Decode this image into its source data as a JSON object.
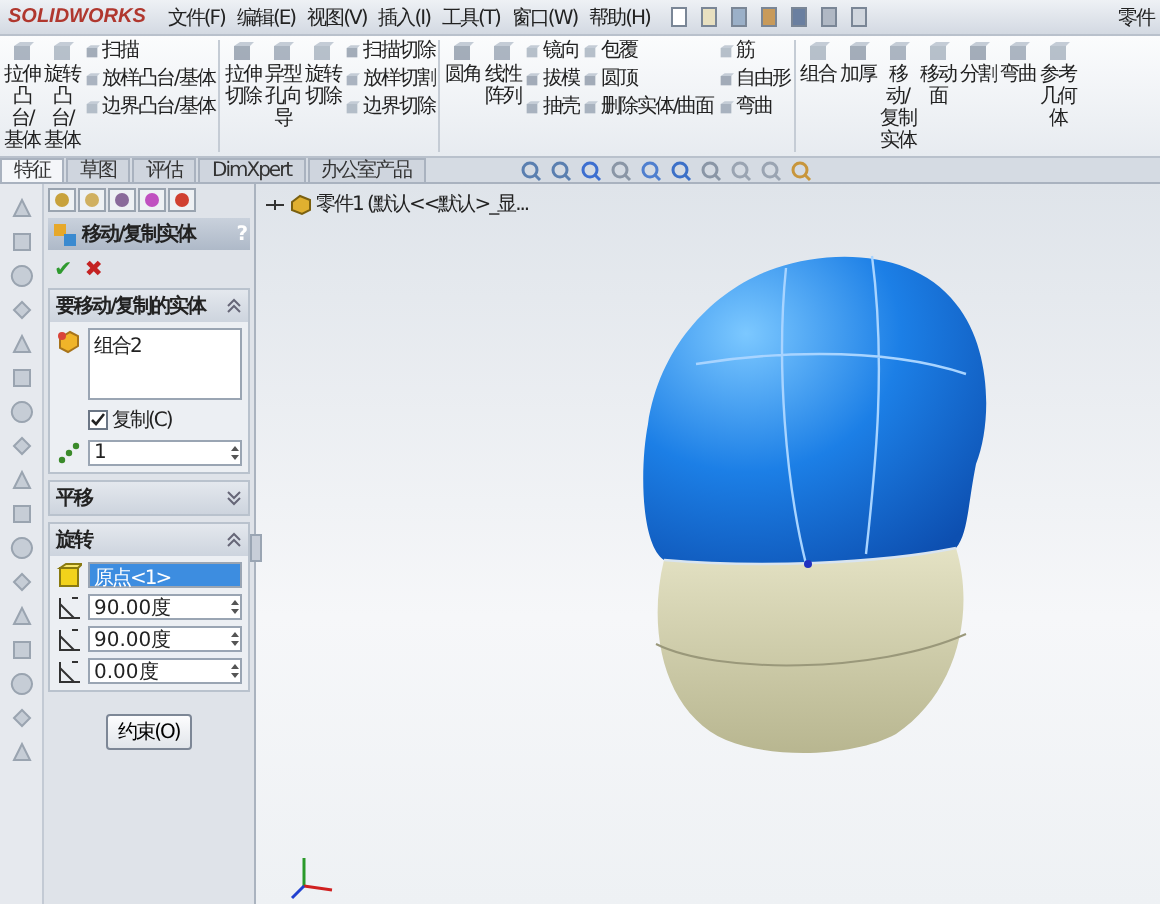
{
  "app": {
    "logo": "SOLIDWORKS",
    "menu": [
      "文件(F)",
      "编辑(E)",
      "视图(V)",
      "插入(I)",
      "工具(T)",
      "窗口(W)",
      "帮助(H)"
    ],
    "doc_title": "零件"
  },
  "ribbon": [
    {
      "kind": "large",
      "label": "拉伸凸台/基体"
    },
    {
      "kind": "large",
      "label": "旋转凸台/基体"
    },
    {
      "kind": "stack",
      "labels": [
        "扫描",
        "放样凸台/基体",
        "边界凸台/基体"
      ]
    },
    {
      "kind": "divider"
    },
    {
      "kind": "large",
      "label": "拉伸切除"
    },
    {
      "kind": "large",
      "label": "异型孔向导"
    },
    {
      "kind": "large",
      "label": "旋转切除"
    },
    {
      "kind": "stack",
      "labels": [
        "扫描切除",
        "放样切割",
        "边界切除"
      ]
    },
    {
      "kind": "divider"
    },
    {
      "kind": "large",
      "label": "圆角"
    },
    {
      "kind": "large",
      "label": "线性阵列"
    },
    {
      "kind": "stack",
      "labels": [
        "镜向",
        "拔模",
        "抽壳"
      ]
    },
    {
      "kind": "stack",
      "labels": [
        "包覆",
        "圆顶",
        "删除实体/曲面"
      ]
    },
    {
      "kind": "stack",
      "labels": [
        "筋",
        "自由形",
        "弯曲"
      ]
    },
    {
      "kind": "divider"
    },
    {
      "kind": "large",
      "label": "组合"
    },
    {
      "kind": "large",
      "label": "加厚"
    },
    {
      "kind": "large",
      "label": "移动/复制实体"
    },
    {
      "kind": "large",
      "label": "移动面"
    },
    {
      "kind": "large",
      "label": "分割"
    },
    {
      "kind": "large",
      "label": "弯曲"
    },
    {
      "kind": "large",
      "label": "参考几何体"
    }
  ],
  "tabs": [
    {
      "label": "特征",
      "selected": true
    },
    {
      "label": "草图",
      "selected": false
    },
    {
      "label": "评估",
      "selected": false
    },
    {
      "label": "DimXpert",
      "selected": false
    },
    {
      "label": "办公室产品",
      "selected": false
    }
  ],
  "property_manager": {
    "title": "移动/复制实体",
    "help": "?",
    "ok": "✔",
    "cancel": "✖",
    "sections": [
      {
        "kind": "bodies",
        "title": "要移动/复制的实体",
        "expanded": true,
        "bodies": [
          "组合2"
        ],
        "copy": {
          "label": "复制(C)",
          "checked": true
        },
        "copies": "1"
      },
      {
        "kind": "translate",
        "title": "平移",
        "expanded": false
      },
      {
        "kind": "rotate",
        "title": "旋转",
        "expanded": true,
        "reference": {
          "value": "原点<1>",
          "selected": true
        },
        "angles": [
          "90.00度",
          "90.00度",
          "0.00度"
        ]
      }
    ],
    "button": "约束(O)"
  },
  "tree_flyout": {
    "label": "零件1 (默认<<默认>_显..."
  }
}
